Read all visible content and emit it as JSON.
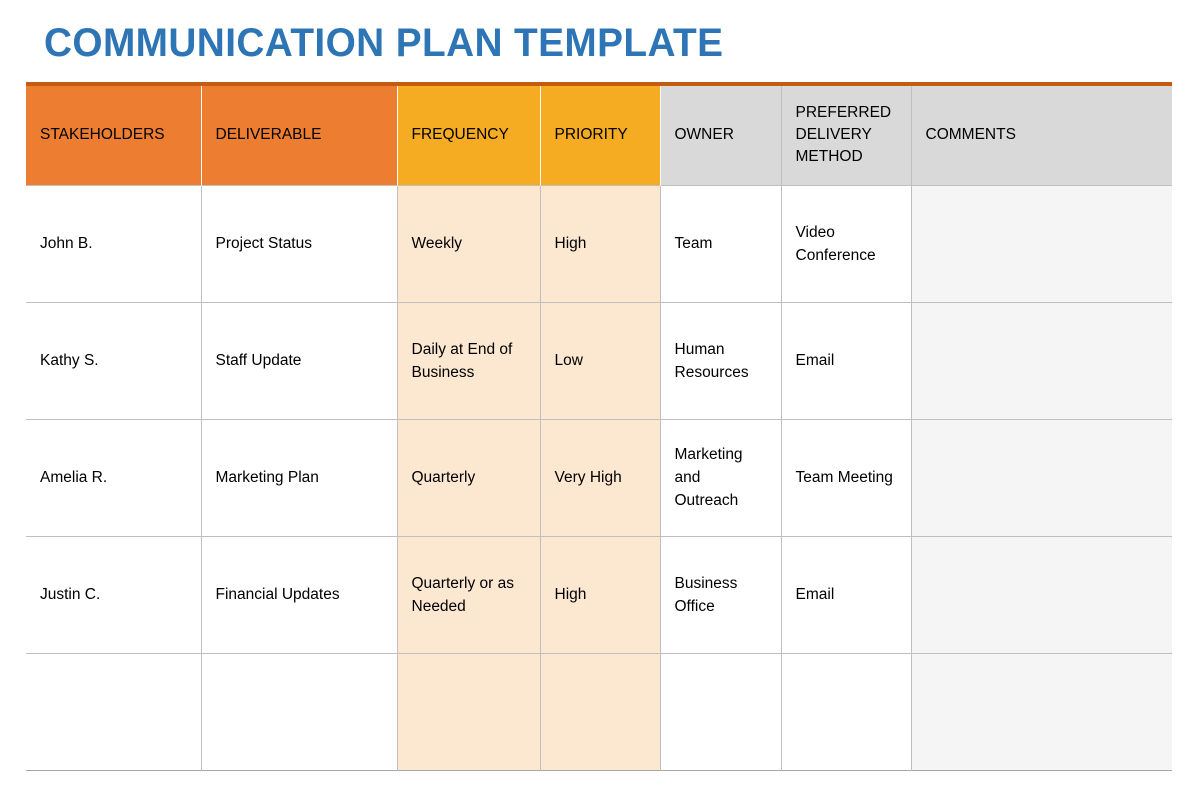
{
  "document": {
    "title": "COMMUNICATION PLAN TEMPLATE"
  },
  "colors": {
    "title_blue": "#2E75B6",
    "header_orange": "#ED7D31",
    "header_amber": "#F5AB22",
    "header_gray": "#D9D9D9",
    "top_rule": "#C55A11",
    "cell_peach": "#FCE7D0",
    "cell_comments": "#F5F5F5",
    "grid_line": "#BFBFBF"
  },
  "table": {
    "columns": [
      {
        "key": "stakeholders",
        "label": "STAKEHOLDERS",
        "header_style": "orange",
        "cell_style": "white"
      },
      {
        "key": "deliverable",
        "label": "DELIVERABLE",
        "header_style": "orange",
        "cell_style": "white"
      },
      {
        "key": "frequency",
        "label": "FREQUENCY",
        "header_style": "amber",
        "cell_style": "peach"
      },
      {
        "key": "priority",
        "label": "PRIORITY",
        "header_style": "amber",
        "cell_style": "peach"
      },
      {
        "key": "owner",
        "label": "OWNER",
        "header_style": "gray",
        "cell_style": "white"
      },
      {
        "key": "method",
        "label": "PREFERRED DELIVERY METHOD",
        "header_style": "gray",
        "cell_style": "white"
      },
      {
        "key": "comments",
        "label": "COMMENTS",
        "header_style": "gray",
        "cell_style": "ltgray"
      }
    ],
    "rows": [
      {
        "stakeholders": "John B.",
        "deliverable": "Project Status",
        "frequency": "Weekly",
        "priority": "High",
        "owner": "Team",
        "method": "Video Conference",
        "comments": ""
      },
      {
        "stakeholders": "Kathy S.",
        "deliverable": "Staff Update",
        "frequency": "Daily at End of Business",
        "priority": "Low",
        "owner": "Human Resources",
        "method": "Email",
        "comments": ""
      },
      {
        "stakeholders": "Amelia R.",
        "deliverable": "Marketing Plan",
        "frequency": "Quarterly",
        "priority": "Very High",
        "owner": "Marketing and Outreach",
        "method": "Team Meeting",
        "comments": ""
      },
      {
        "stakeholders": "Justin C.",
        "deliverable": "Financial Updates",
        "frequency": "Quarterly or as Needed",
        "priority": "High",
        "owner": "Business Office",
        "method": "Email",
        "comments": ""
      },
      {
        "stakeholders": "",
        "deliverable": "",
        "frequency": "",
        "priority": "",
        "owner": "",
        "method": "",
        "comments": ""
      }
    ]
  }
}
